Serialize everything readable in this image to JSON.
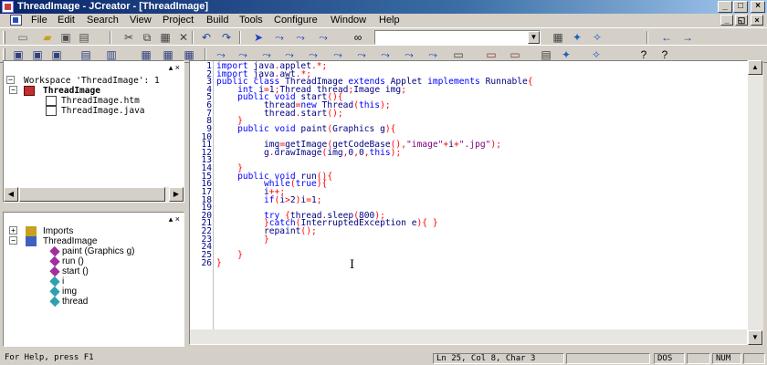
{
  "window": {
    "title": "ThreadImage - JCreator - [ThreadImage]",
    "controls": {
      "minimize": "_",
      "maximize": "□",
      "close": "×"
    }
  },
  "menu": {
    "items": [
      "File",
      "Edit",
      "Search",
      "View",
      "Project",
      "Build",
      "Tools",
      "Configure",
      "Window",
      "Help"
    ],
    "mdi_controls": {
      "minimize": "_",
      "restore": "◱",
      "close": "×"
    }
  },
  "toolbar1": {
    "icons": [
      "new-file-icon",
      "open-folder-icon",
      "save-icon",
      "save-all-icon",
      "cut-icon",
      "copy-icon",
      "paste-icon",
      "delete-icon",
      "undo-icon",
      "redo-icon",
      "bookmark-toggle-icon",
      "bookmark-next-icon",
      "bookmark-prev-icon",
      "bookmark-clear-icon",
      "find-binoculars-icon",
      "find-combo-icon",
      "find-next-icon",
      "find-prev-icon",
      "replace-icon",
      "go-back-icon",
      "go-forward-icon"
    ],
    "find_value": ""
  },
  "toolbar2": {
    "icons": [
      "workspace-view-icon",
      "file-view-icon",
      "package-view-icon",
      "class-view-icon",
      "output-view-icon",
      "compile-icon",
      "build-icon",
      "run-icon",
      "debug-icon",
      "stop-icon",
      "indent-icon",
      "outdent-icon",
      "comment-icon",
      "uncomment-icon",
      "tab-icon",
      "help-icon",
      "context-help-icon"
    ]
  },
  "workspace_panel": {
    "title": "Workspace 'ThreadImage': 1",
    "project": "ThreadImage",
    "files": [
      "ThreadImage.htm",
      "ThreadImage.java"
    ]
  },
  "class_panel": {
    "imports": "Imports",
    "class_name": "ThreadImage",
    "members": [
      "paint (Graphics g)",
      "run ()",
      "start ()",
      "i",
      "img",
      "thread"
    ]
  },
  "editor": {
    "lines": [
      {
        "n": "1",
        "code": "import java.applet.*;"
      },
      {
        "n": "2",
        "code": "import java.awt.*;"
      },
      {
        "n": "3",
        "code": "public class ThreadImage extends Applet implements Runnable{"
      },
      {
        "n": "4",
        "code": "    int i=1;Thread thread;Image img;"
      },
      {
        "n": "5",
        "code": "    public void start(){"
      },
      {
        "n": "6",
        "code": "         thread=new Thread(this);"
      },
      {
        "n": "7",
        "code": "         thread.start();"
      },
      {
        "n": "8",
        "code": "    }"
      },
      {
        "n": "9",
        "code": "    public void paint(Graphics g){"
      },
      {
        "n": "10",
        "code": ""
      },
      {
        "n": "11",
        "code": "         img=getImage(getCodeBase(),\"image\"+i+\".jpg\");"
      },
      {
        "n": "12",
        "code": "         g.drawImage(img,0,0,this);"
      },
      {
        "n": "13",
        "code": ""
      },
      {
        "n": "14",
        "code": "    }"
      },
      {
        "n": "15",
        "code": "    public void run(){"
      },
      {
        "n": "16",
        "code": "         while(true){"
      },
      {
        "n": "17",
        "code": "         i++;"
      },
      {
        "n": "18",
        "code": "         if(i>2)i=1;"
      },
      {
        "n": "19",
        "code": ""
      },
      {
        "n": "20",
        "code": "         try {thread.sleep(800);"
      },
      {
        "n": "21",
        "code": "         }catch(InterruptedException e){ }"
      },
      {
        "n": "22",
        "code": "         repaint();"
      },
      {
        "n": "23",
        "code": "         }"
      },
      {
        "n": "24",
        "code": ""
      },
      {
        "n": "25",
        "code": "    }"
      },
      {
        "n": "26",
        "code": "}"
      }
    ]
  },
  "status": {
    "help": "For Help, press F1",
    "position": "Ln 25, Col 8, Char 3",
    "mode": "DOS",
    "num": "NUM"
  },
  "colors": {
    "title_bar": "#0a246a",
    "keyword": "#0000ff",
    "string": "#800080",
    "operator": "#ff0000",
    "code_text": "#000080"
  }
}
